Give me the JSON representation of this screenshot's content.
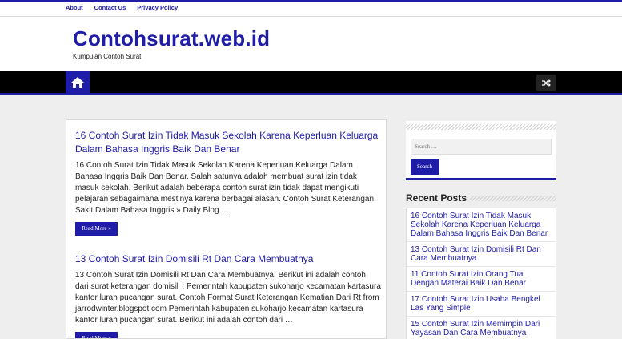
{
  "topbar": {
    "links": [
      "About",
      "Contact Us",
      "Privacy Policy"
    ]
  },
  "header": {
    "site_title": "Contohsurat.web.id",
    "tagline": "Kumpulan Contoh Surat"
  },
  "nav": {
    "home_icon": "home-icon",
    "shuffle_icon": "shuffle-icon"
  },
  "posts": [
    {
      "title": "16 Contoh Surat Izin Tidak Masuk Sekolah Karena Keperluan Keluarga Dalam Bahasa Inggris Baik Dan Benar",
      "excerpt": "16 Contoh Surat Izin Tidak Masuk Sekolah Karena Keperluan Keluarga Dalam Bahasa Inggris Baik Dan Benar. Salah satunya adalah membuat surat izin tidak masuk sekolah. Berikut adalah beberapa contoh surat izin tidak dapat mengikuti pelajaran sebagaimana mestinya karena berbagai alasan. Contoh Surat Keterangan Sakit Dalam Bahasa Inggris » Daily Blog …",
      "read_more": "Read More »"
    },
    {
      "title": "13 Contoh Surat Izin Domisili Rt Dan Cara Membuatnya",
      "excerpt": "13 Contoh Surat Izin Domisili Rt Dan Cara Membuatnya. Berikut ini adalah contoh dari surat keterangan domisili : Pemerintah kabupaten sukoharjo kecamatan kartasura kantor lurah pucangan surat. Contoh Format Surat Keterangan Kematian Dari Rt from jarrodwinter.blogspot.com Pemerintah kabupaten sukoharjo kecamatan kartasura kantor lurah pucangan surat. Berikut ini adalah contoh dari …",
      "read_more": "Read More »"
    }
  ],
  "sidebar": {
    "search_placeholder": "Search …",
    "search_button": "Search",
    "recent_title": "Recent Posts",
    "recent_posts": [
      "16 Contoh Surat Izin Tidak Masuk Sekolah Karena Keperluan Keluarga Dalam Bahasa Inggris Baik Dan Benar",
      "13 Contoh Surat Izin Domisili Rt Dan Cara Membuatnya",
      "11 Contoh Surat Izin Orang Tua Dengan Materai Baik Dan Benar",
      "17 Contoh Surat Izin Usaha Bengkel Las Yang Simple",
      "15 Contoh Surat Izin Memimpin Dari Yayasan Dan Cara Membuatnya"
    ]
  },
  "colors": {
    "accent": "#1f1ca8",
    "navbar": "#000000",
    "background": "#eeeeee"
  }
}
